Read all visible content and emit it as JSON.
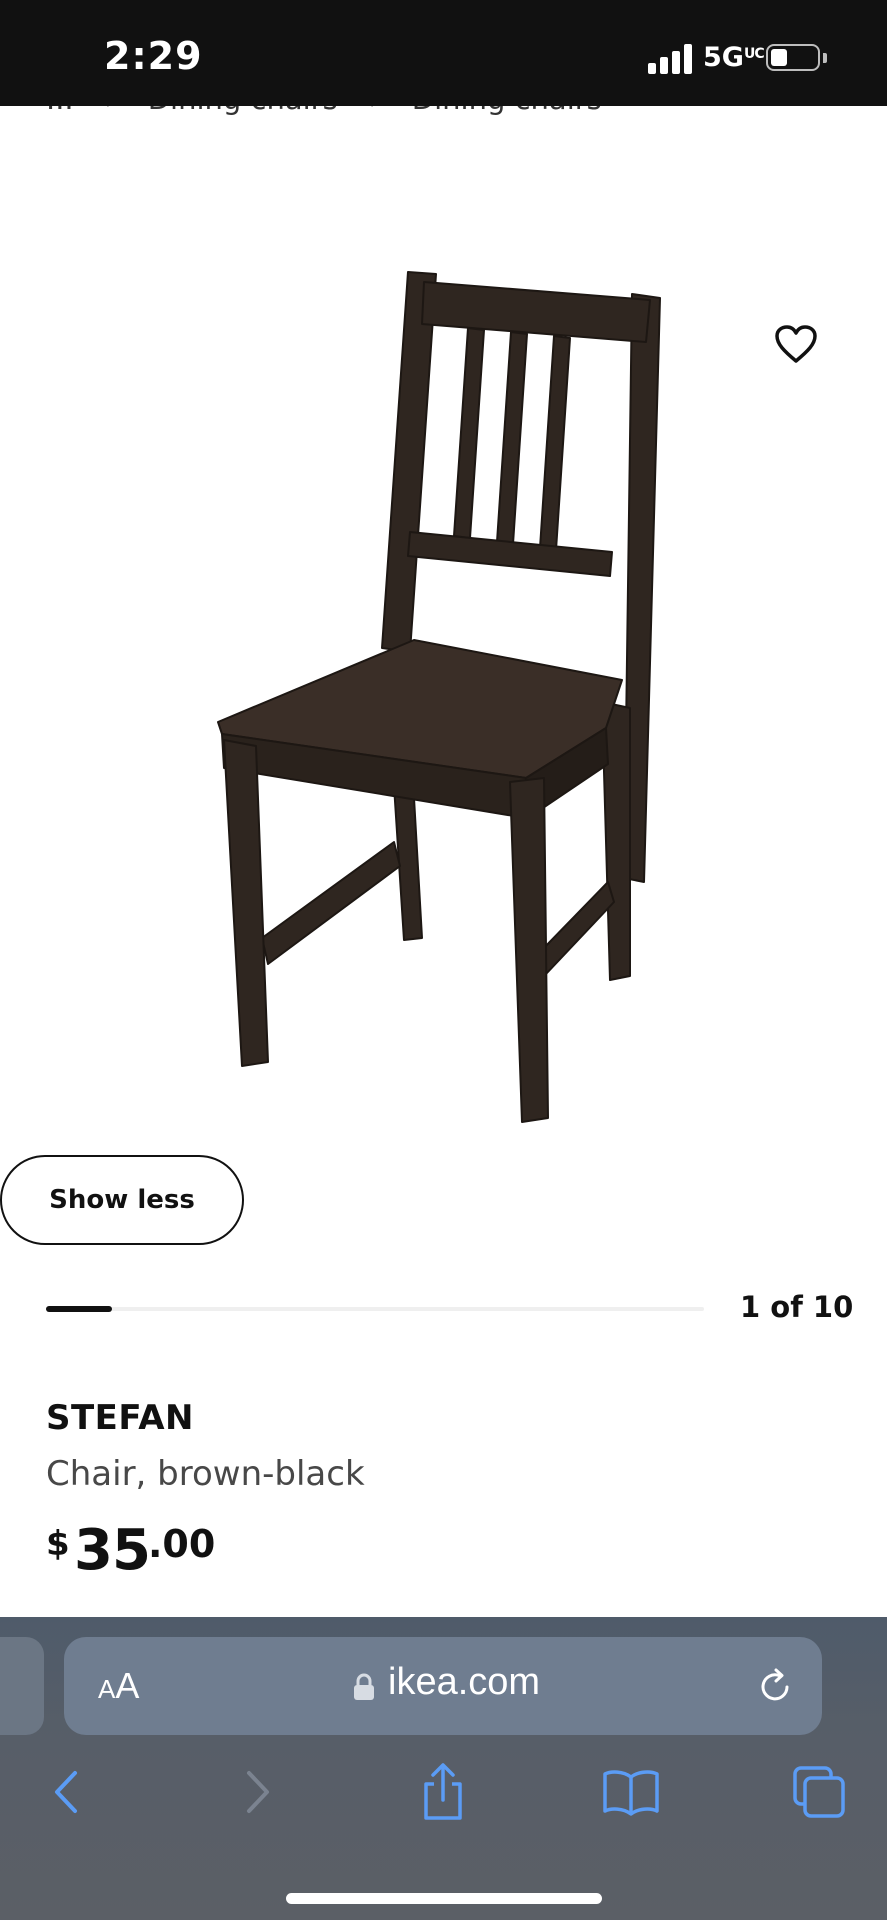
{
  "status_bar": {
    "time": "2:29",
    "network": "5G",
    "network_sup": "UC"
  },
  "breadcrumb": {
    "items": [
      "...",
      "Dining chairs",
      "Dining chairs"
    ],
    "separator": "›"
  },
  "gallery": {
    "show_less_label": "Show less",
    "counter": "1 of 10",
    "current": 1,
    "total": 10
  },
  "product": {
    "name": "STEFAN",
    "description": "Chair, brown-black",
    "price_currency": "$",
    "price_whole": "35",
    "price_decimal": ".00"
  },
  "browser": {
    "aa_label_small": "A",
    "aa_label_large": "A",
    "url": "ikea.com"
  },
  "colors": {
    "status_bg": "#111111",
    "chair": "#2f2620",
    "browser_bar": "#575e68",
    "browser_icon": "#5b9cf5"
  }
}
